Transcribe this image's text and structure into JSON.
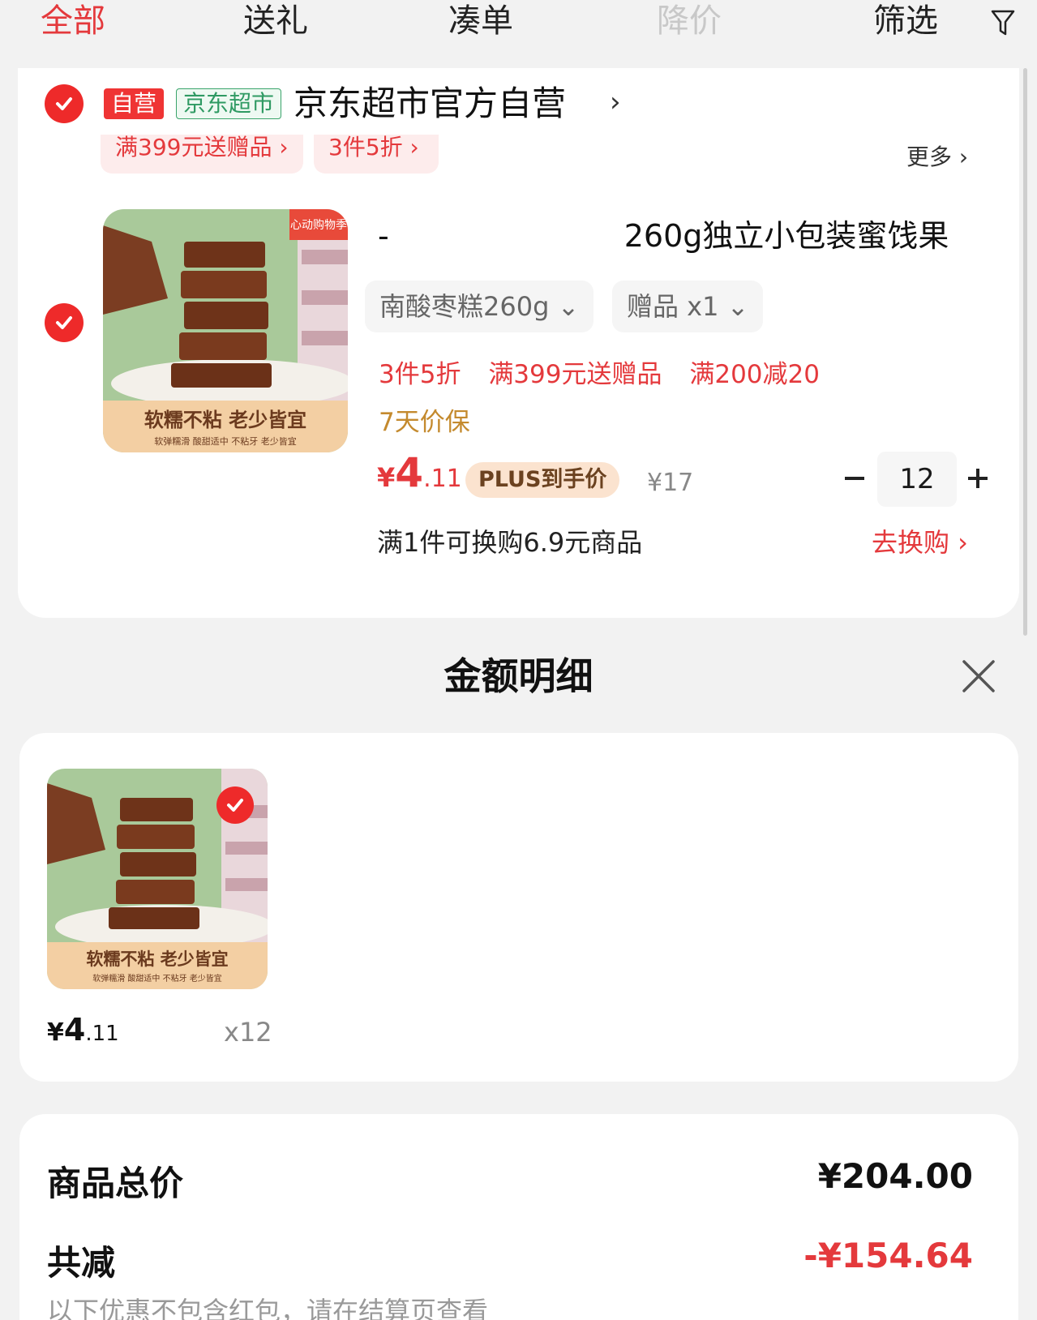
{
  "tabs": [
    "全部",
    "送礼",
    "凑单",
    "降价",
    "筛选"
  ],
  "cart": {
    "tag_self": "自营",
    "tag_market": "京东超市",
    "store_name": "京东超市官方自营",
    "store_arrow": "›",
    "promo_chips": [
      "满399元送赠品 ›",
      "3件5折 ›"
    ],
    "more": "更多 ›",
    "product": {
      "image_badge": "心动购物季",
      "image_caption": "软糯不粘 老少皆宜",
      "image_subcaption": "软弹糯滑 酸甜适中 不粘牙 老少皆宜",
      "title_start": "-",
      "title_end": "260g独立小包装蜜饯果",
      "spec": "南酸枣糕260g ⌄",
      "gift": "赠品 x1 ⌄",
      "promos": [
        "3件5折",
        "满399元送赠品",
        "满200减20"
      ],
      "guarantee": "7天价保",
      "price_currency": "¥",
      "price_int": "4",
      "price_dec": ".11",
      "plus_label": "PLUS到手价",
      "original_price": "¥17",
      "quantity": "12",
      "swap_text": "满1件可换购6.9元商品",
      "swap_link": "去换购 ›"
    }
  },
  "sheet": {
    "title": "金额明细",
    "item": {
      "price_currency": "¥",
      "price_int": "4",
      "price_dec": ".11",
      "qty": "x12"
    },
    "summary": {
      "total_label": "商品总价",
      "total_value": "¥204.00",
      "discount_label": "共减",
      "discount_value": "-¥154.64",
      "note": "以下优惠不包含红包，请在结算页查看"
    }
  },
  "colors": {
    "accent": "#e4393c",
    "check": "#ee2a2a",
    "market_green": "#2f9a63",
    "guarantee": "#c48a2e",
    "plus_badge_bg": "#fbe3cf"
  },
  "icons": [
    "filter-icon",
    "check-icon",
    "chevron-right-icon",
    "minus-icon",
    "plus-icon",
    "close-icon"
  ]
}
